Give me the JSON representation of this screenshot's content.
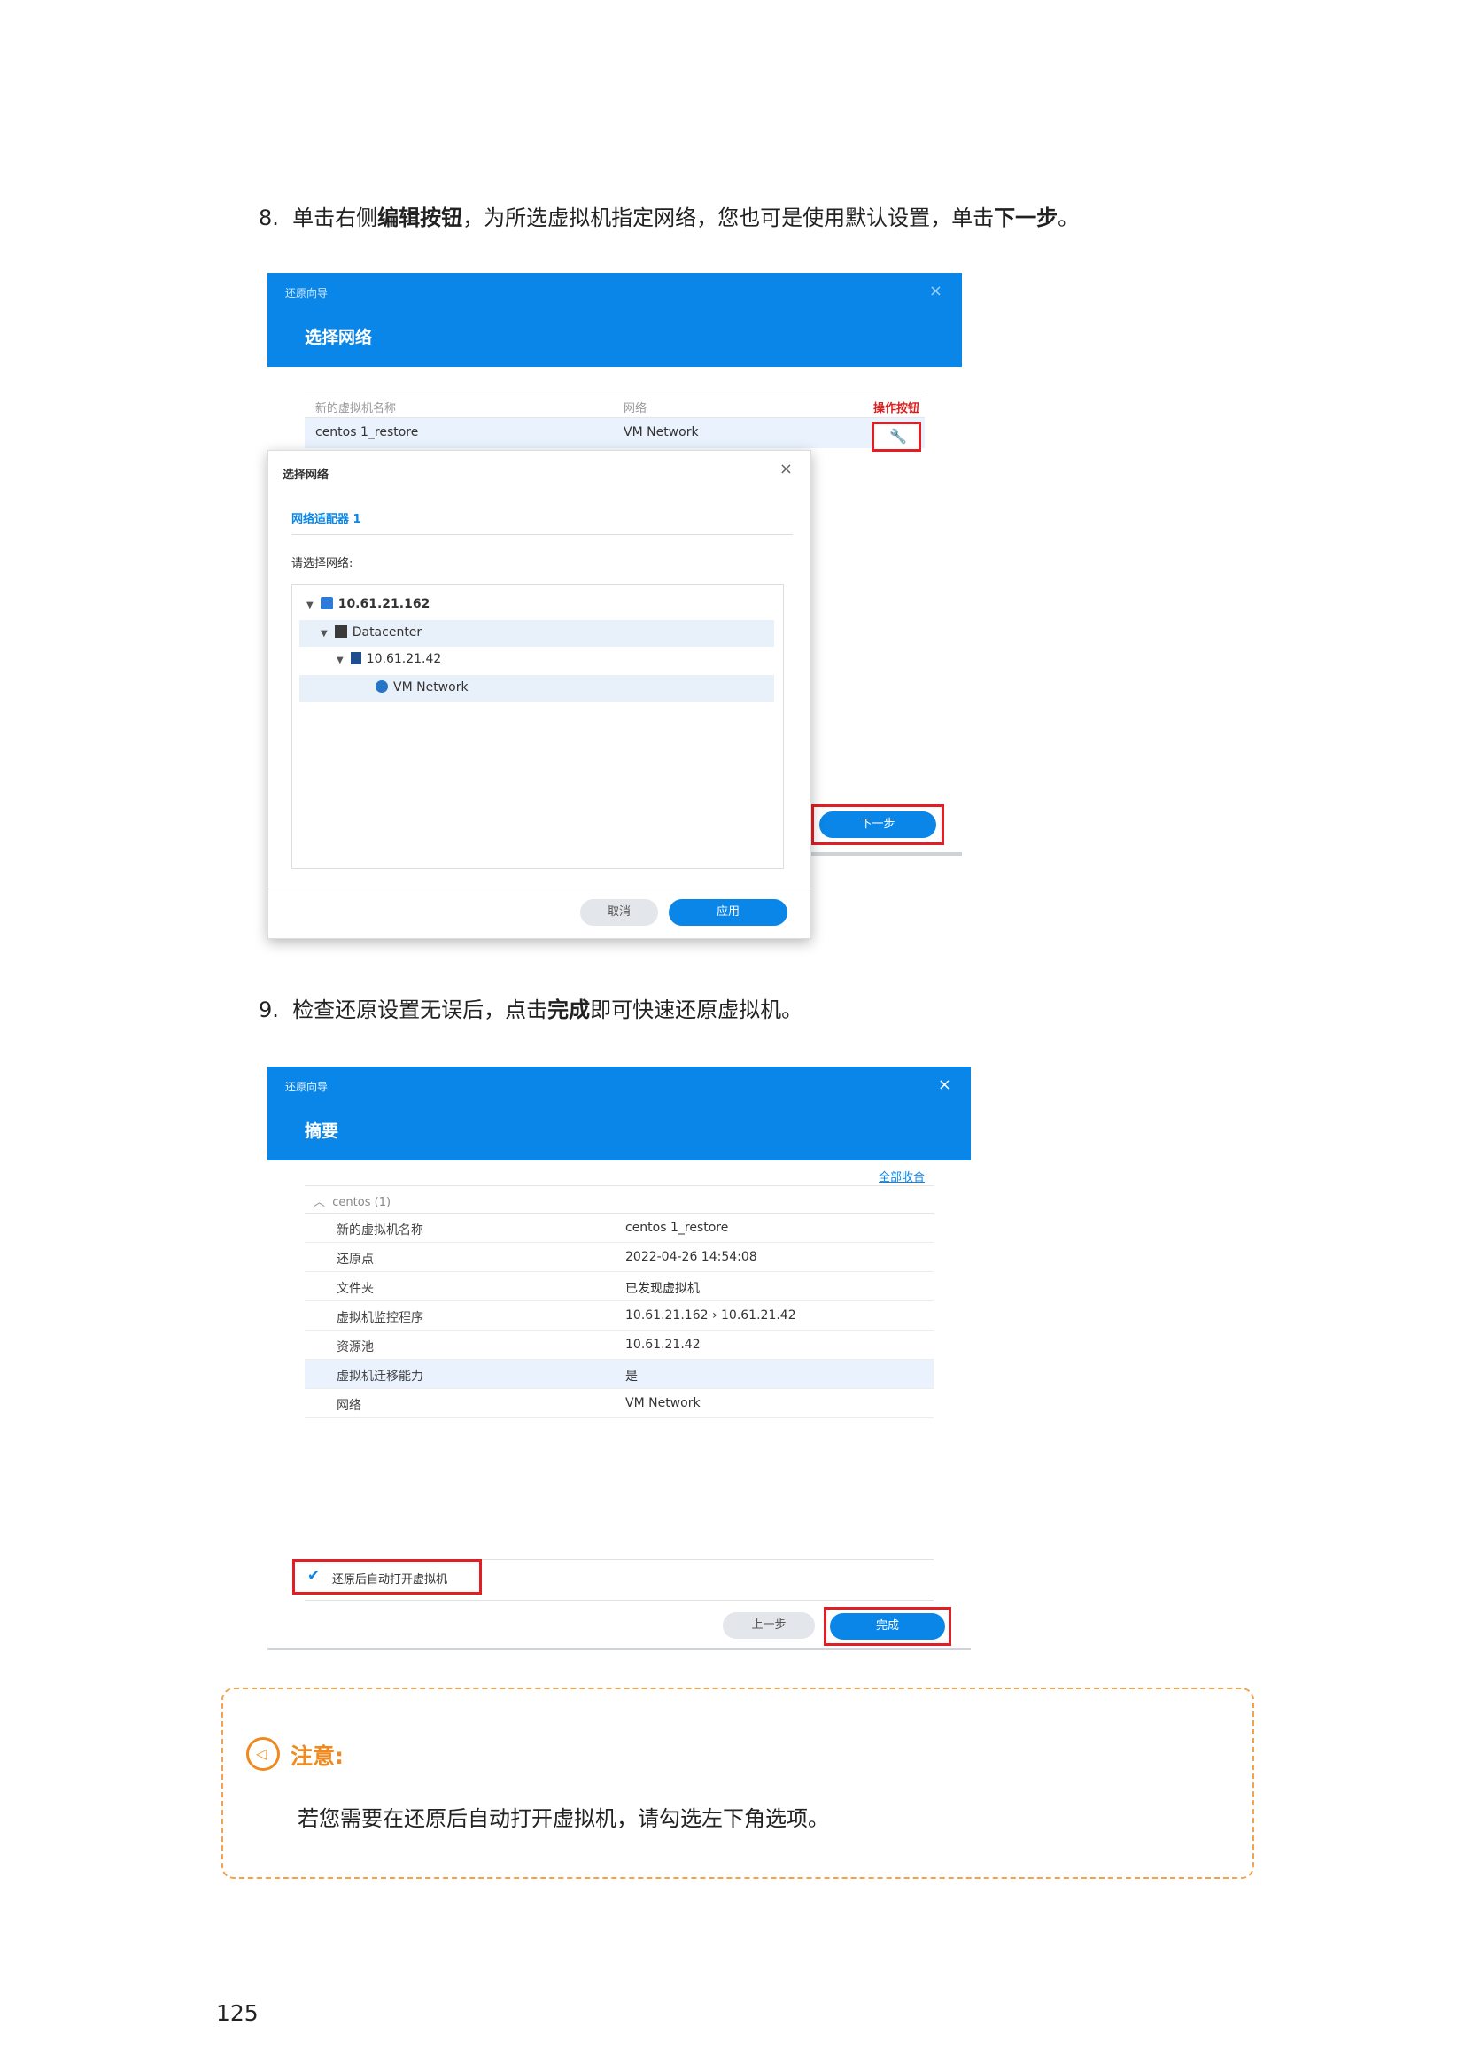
{
  "step8": {
    "number": "8.",
    "text_a": "单击右侧",
    "bold_a": "编辑按钮",
    "text_b": "，为所选虚拟机指定网络，您也可是使用默认设置，单击",
    "bold_b": "下一步",
    "text_c": "。"
  },
  "shot1": {
    "wizard_title": "还原向导",
    "wizard_subtitle": "选择网络",
    "close_icon": "×",
    "table": {
      "col_vm": "新的虚拟机名称",
      "col_network": "网络",
      "col_action": "操作按钮",
      "row_vm": "centos 1_restore",
      "row_network": "VM Network"
    },
    "dialog": {
      "title": "选择网络",
      "close_icon": "×",
      "tab": "网络适配器 1",
      "prompt": "请选择网络:",
      "tree": [
        {
          "label": "10.61.21.162",
          "icon": "host-icon"
        },
        {
          "label": "Datacenter",
          "icon": "datacenter-icon"
        },
        {
          "label": "10.61.21.42",
          "icon": "server-icon"
        },
        {
          "label": "VM Network",
          "icon": "network-icon"
        }
      ],
      "cancel": "取消",
      "apply": "应用"
    },
    "next": "下一步"
  },
  "step9": {
    "number": "9.",
    "text_a": "检查还原设置无误后，点击",
    "bold_a": "完成",
    "text_b": "即可快速还原虚拟机。"
  },
  "shot2": {
    "wizard_title": "还原向导",
    "wizard_subtitle": "摘要",
    "close_icon": "×",
    "collapse_all": "全部收合",
    "group": "centos (1)",
    "rows": [
      {
        "key": "新的虚拟机名称",
        "value": "centos 1_restore"
      },
      {
        "key": "还原点",
        "value": "2022-04-26 14:54:08"
      },
      {
        "key": "文件夹",
        "value": "已发现虚拟机"
      },
      {
        "key": "虚拟机监控程序",
        "value": "10.61.21.162 › 10.61.21.42"
      },
      {
        "key": "资源池",
        "value": "10.61.21.42"
      },
      {
        "key": "虚拟机迁移能力",
        "value": "是"
      },
      {
        "key": "网络",
        "value": "VM Network"
      }
    ],
    "checkbox_label": "还原后自动打开虚拟机",
    "checkbox_checked": true,
    "prev": "上一步",
    "finish": "完成"
  },
  "note": {
    "title": "注意:",
    "text": "若您需要在还原后自动打开虚拟机，请勾选左下角选项。"
  },
  "page_number": "125",
  "colors": {
    "accent_blue": "#0a86e8",
    "highlight_red": "#e01e24",
    "note_orange": "#f08a1e"
  }
}
